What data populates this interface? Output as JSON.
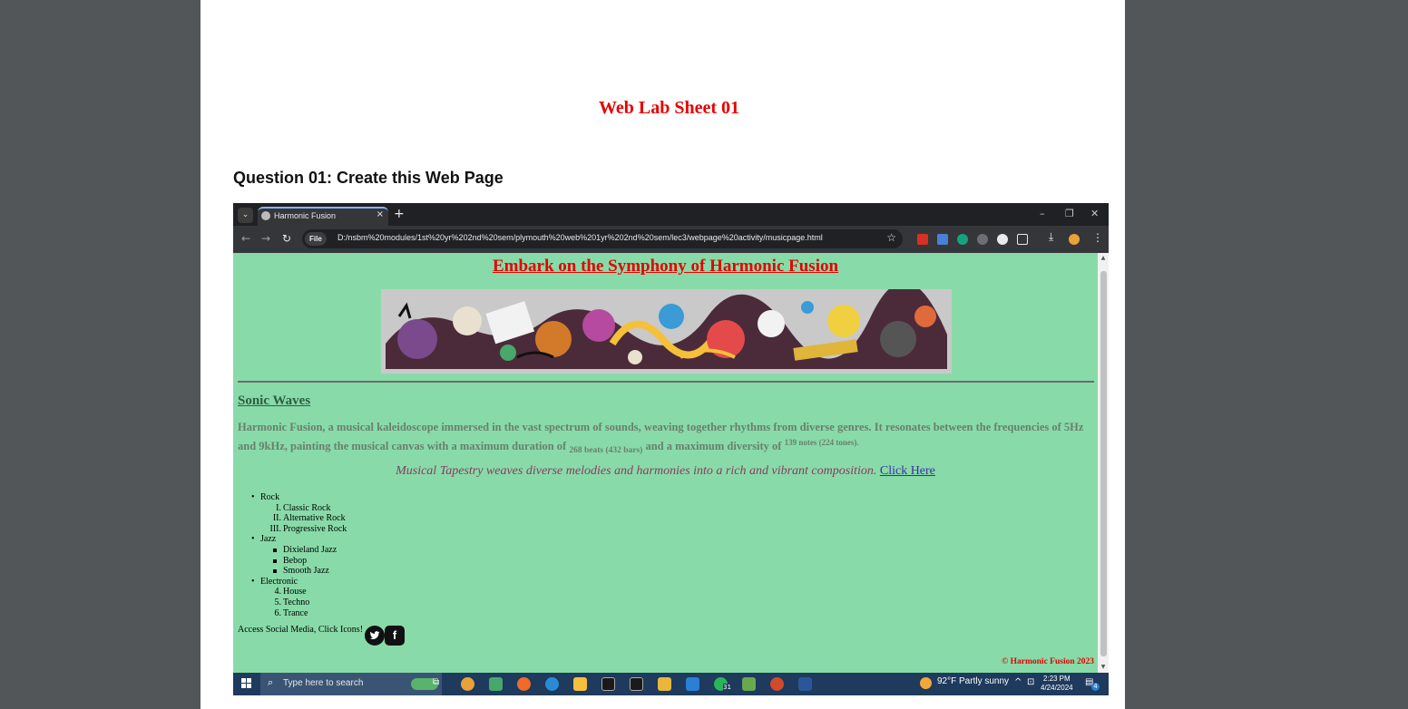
{
  "document": {
    "sheet_title": "Web Lab Sheet 01",
    "question": "Question 01: Create this Web Page"
  },
  "browser": {
    "tab_title": "Harmonic Fusion",
    "file_chip": "File",
    "url": "D:/nsbm%20modules/1st%20yr%202nd%20sem/plymouth%20web%201yr%202nd%20sem/lec3/webpage%20activity/musicpage.html"
  },
  "webpage": {
    "main_heading": "Embark on the Symphony of Harmonic Fusion",
    "section_heading": "Sonic Waves",
    "paragraph": {
      "text1": "Harmonic Fusion, a musical kaleidoscope immersed in the vast spectrum of sounds, weaving together rhythms from diverse genres. It resonates between the frequencies of 5Hz and 9kHz, painting the musical canvas with a maximum duration of",
      "sub1": "268 beats (432 bars)",
      "text2": "and a maximum diversity of",
      "sup1": "139 notes (224 tones)."
    },
    "tagline": "Musical Tapestry weaves diverse melodies and harmonies into a rich and vibrant composition.",
    "link_label": "Click Here",
    "genres": [
      {
        "name": "Rock",
        "items": [
          {
            "marker": "I.",
            "label": "Classic Rock"
          },
          {
            "marker": "II.",
            "label": "Alternative Rock"
          },
          {
            "marker": "III.",
            "label": "Progressive Rock"
          }
        ]
      },
      {
        "name": "Jazz",
        "items": [
          {
            "marker": "",
            "label": "Dixieland Jazz"
          },
          {
            "marker": "",
            "label": "Bebop"
          },
          {
            "marker": "",
            "label": "Smooth Jazz"
          }
        ]
      },
      {
        "name": "Electronic",
        "items": [
          {
            "marker": "4.",
            "label": "House"
          },
          {
            "marker": "5.",
            "label": "Techno"
          },
          {
            "marker": "6.",
            "label": "Trance"
          }
        ]
      }
    ],
    "social_text": "Access Social Media, Click Icons!",
    "copyright": "© Harmonic Fusion 2023"
  },
  "taskbar": {
    "search_placeholder": "Type here to search",
    "weather": "92°F  Partly sunny",
    "time": "2:23 PM",
    "date": "4/24/2024",
    "notification_count": "4",
    "calendar_badge": "31"
  }
}
